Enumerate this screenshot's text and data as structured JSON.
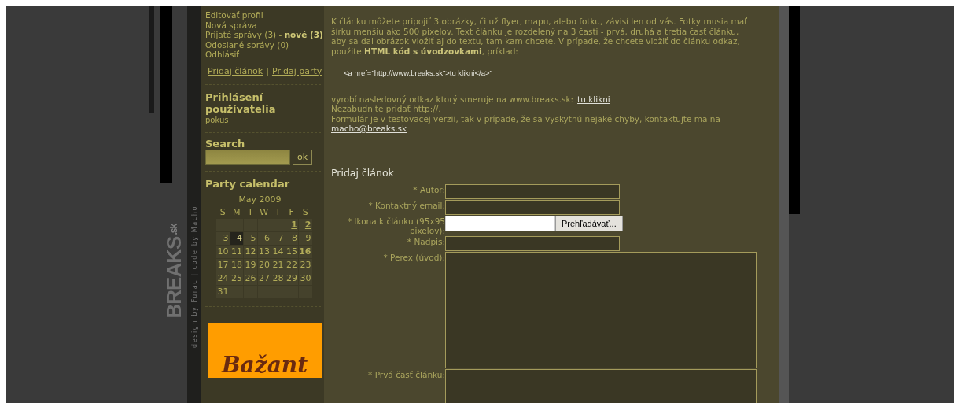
{
  "left_logo": {
    "text": "BREAKS",
    "suffix": ".sk"
  },
  "credits": "design by Furac | code by Macho",
  "sidebar": {
    "user_links": [
      {
        "label": "Editovať profil"
      },
      {
        "label": "Nová správa"
      },
      {
        "label": "Prijaté správy (3) - **nové (3)**"
      },
      {
        "label": "Odoslané správy (0)"
      },
      {
        "label": "Odhlásiť"
      }
    ],
    "action_links": [
      {
        "label": "Pridaj článok"
      },
      {
        "label": "Pridaj party"
      }
    ],
    "action_separator": "|",
    "login_title": "Prihlásení používatelia",
    "logged_users": "pokus",
    "search_title": "Search",
    "search_button": "ok",
    "calendar": {
      "title": "Party calendar",
      "month": "May 2009",
      "weekdays": [
        "S",
        "M",
        "T",
        "W",
        "T",
        "F",
        "S"
      ],
      "weeks": [
        [
          {
            "kind": "empty"
          },
          {
            "kind": "empty"
          },
          {
            "kind": "empty"
          },
          {
            "kind": "empty"
          },
          {
            "kind": "empty"
          },
          {
            "day": "1",
            "kind": "link",
            "selected": false
          },
          {
            "day": "2",
            "kind": "link",
            "selected": false
          }
        ],
        [
          {
            "day": "3",
            "kind": "plain",
            "selected": false
          },
          {
            "day": "4",
            "kind": "plain",
            "selected": true
          },
          {
            "day": "5",
            "kind": "plain",
            "selected": false
          },
          {
            "day": "6",
            "kind": "plain",
            "selected": false
          },
          {
            "day": "7",
            "kind": "plain",
            "selected": false
          },
          {
            "day": "8",
            "kind": "plain",
            "selected": false
          },
          {
            "day": "9",
            "kind": "plain",
            "selected": false
          }
        ],
        [
          {
            "day": "10",
            "kind": "plain",
            "selected": false
          },
          {
            "day": "11",
            "kind": "plain",
            "selected": false
          },
          {
            "day": "12",
            "kind": "plain",
            "selected": false
          },
          {
            "day": "13",
            "kind": "plain",
            "selected": false
          },
          {
            "day": "14",
            "kind": "plain",
            "selected": false
          },
          {
            "day": "15",
            "kind": "plain",
            "selected": false
          },
          {
            "day": "16",
            "kind": "bold",
            "selected": false
          }
        ],
        [
          {
            "day": "17",
            "kind": "plain",
            "selected": false
          },
          {
            "day": "18",
            "kind": "plain",
            "selected": false
          },
          {
            "day": "19",
            "kind": "plain",
            "selected": false
          },
          {
            "day": "20",
            "kind": "plain",
            "selected": false
          },
          {
            "day": "21",
            "kind": "plain",
            "selected": false
          },
          {
            "day": "22",
            "kind": "plain",
            "selected": false
          },
          {
            "day": "23",
            "kind": "plain",
            "selected": false
          }
        ],
        [
          {
            "day": "24",
            "kind": "plain",
            "selected": false
          },
          {
            "day": "25",
            "kind": "plain",
            "selected": false
          },
          {
            "day": "26",
            "kind": "plain",
            "selected": false
          },
          {
            "day": "27",
            "kind": "plain",
            "selected": false
          },
          {
            "day": "28",
            "kind": "plain",
            "selected": false
          },
          {
            "day": "29",
            "kind": "plain",
            "selected": false
          },
          {
            "day": "30",
            "kind": "plain",
            "selected": false
          }
        ],
        [
          {
            "day": "31",
            "kind": "plain",
            "selected": false
          },
          {
            "kind": "empty"
          },
          {
            "kind": "empty"
          },
          {
            "kind": "empty"
          },
          {
            "kind": "empty"
          },
          {
            "kind": "empty"
          },
          {
            "kind": "empty"
          }
        ]
      ]
    },
    "banner": {
      "text": "Bažant"
    }
  },
  "main": {
    "intro": "K článku môžete pripojiť 3 obrázky, či už flyer, mapu, alebo fotku, závisí len od vás. Fotky musia mať šírku menšiu ako 500 pixelov. Text článku je rozdelený na 3 časti - prvá, druhá a tretia časť článku, aby sa dal obrázok vložiť aj do textu, tam kam chcete. V prípade, že chcete vložiť do článku odkaz, použite **HTML kód s úvodzovkami**, príklad:",
    "code_example": "<a href=\"http://www.breaks.sk\">tu klikni</a>\"",
    "result_text": "vyrobí nasledovný odkaz ktorý smeruje na www.breaks.sk:",
    "result_link": "tu klikni",
    "reminder": "Nezabudnite pridať http://.",
    "notice": "Formulár je v testovacej verzii, tak v prípade, že sa vyskytnú nejaké chyby, kontaktujte ma na",
    "notice_email": "macho@breaks.sk",
    "form_title": "Pridaj článok",
    "fields": [
      {
        "label": "* Autor:",
        "kind": "text"
      },
      {
        "label": "* Kontaktný email:",
        "kind": "text"
      },
      {
        "label": "* Ikona k článku (95x95 pixelov):",
        "kind": "file",
        "button": "Prehľadávať..."
      },
      {
        "label": "* Nadpis:",
        "kind": "text"
      },
      {
        "label": "* Perex (úvod):",
        "kind": "textarea"
      },
      {
        "label": "* Prvá časť článku:",
        "kind": "textarea"
      }
    ]
  }
}
